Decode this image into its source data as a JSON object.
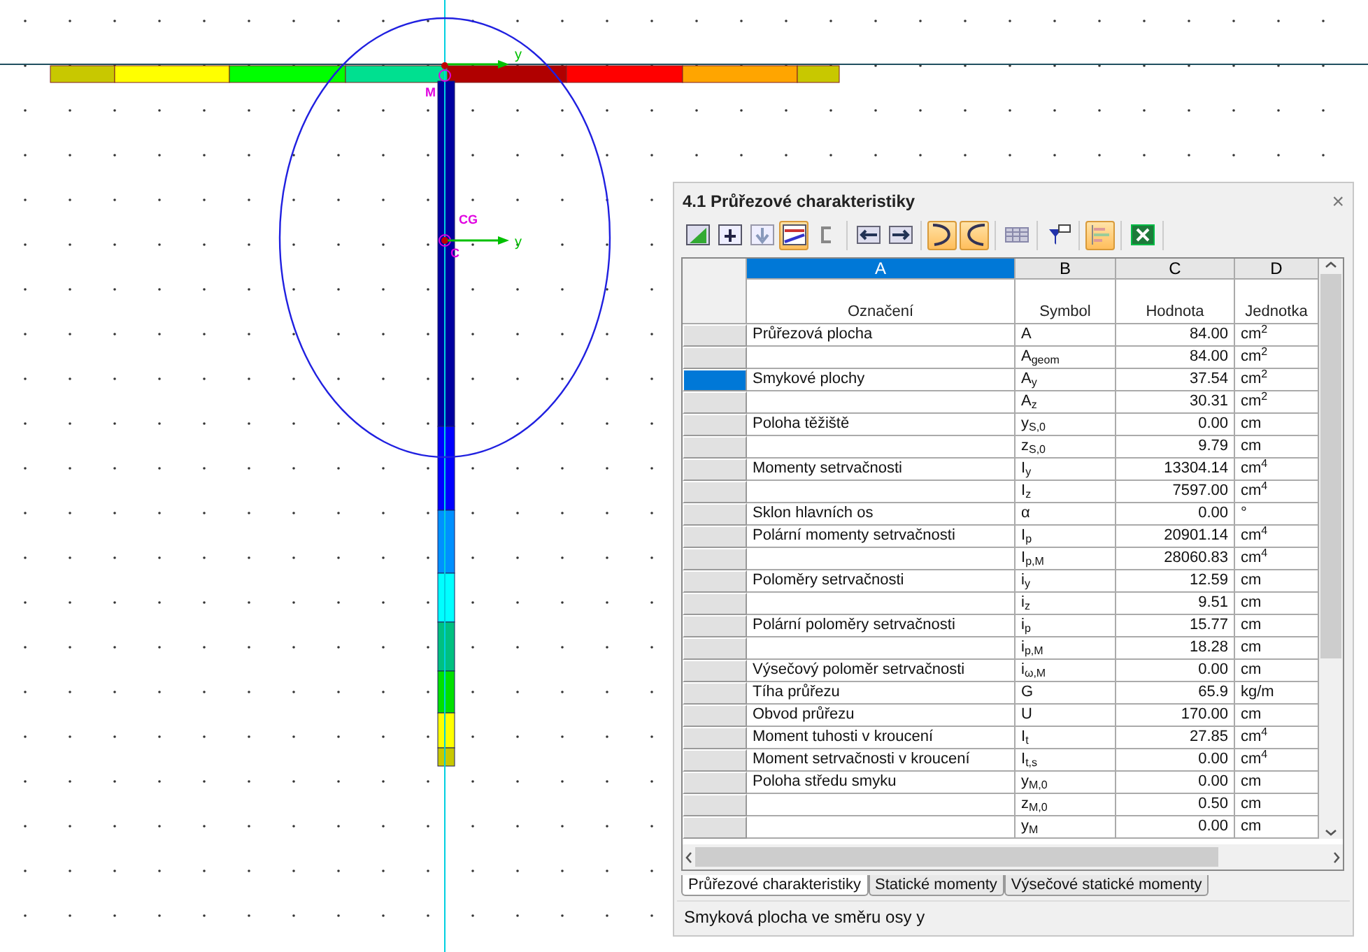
{
  "canvas": {
    "labels": [
      {
        "kind": "axis",
        "text": "y"
      },
      {
        "kind": "point",
        "text": "M"
      },
      {
        "kind": "point",
        "text": "CG"
      },
      {
        "kind": "point",
        "text": "C"
      },
      {
        "kind": "axis",
        "text": "y"
      }
    ]
  },
  "panel": {
    "title": "4.1 Průřezové charakteristiky",
    "close": "×",
    "toolbar": [
      [
        {
          "kind": "table-green",
          "pressed": false
        },
        {
          "kind": "insert",
          "pressed": false
        },
        {
          "kind": "down",
          "pressed": false
        },
        {
          "kind": "colors",
          "pressed": true
        },
        {
          "kind": "bracket",
          "pressed": false
        }
      ],
      [
        {
          "kind": "left",
          "pressed": false
        },
        {
          "kind": "right",
          "pressed": false
        }
      ],
      [
        {
          "kind": "undo",
          "pressed": true
        },
        {
          "kind": "redo",
          "pressed": true
        }
      ],
      [
        {
          "kind": "grid",
          "pressed": false
        }
      ],
      [
        {
          "kind": "filter",
          "pressed": false
        }
      ],
      [
        {
          "kind": "bars",
          "pressed": true
        }
      ],
      [
        {
          "kind": "excel",
          "pressed": false
        }
      ]
    ],
    "columns": [
      {
        "letter": "A",
        "heading": "Označení",
        "selected": true
      },
      {
        "letter": "B",
        "heading": "Symbol",
        "selected": false
      },
      {
        "letter": "C",
        "heading": "Hodnota",
        "selected": false
      },
      {
        "letter": "D",
        "heading": "Jednotka",
        "selected": false
      }
    ],
    "rows": [
      {
        "label": "Průřezová plocha",
        "symbol": "A",
        "value": "84.00",
        "unit": "cm$^{2}$",
        "selected": false
      },
      {
        "symbol": "A$_{geom}$",
        "value": "84.00",
        "unit": "cm$^{2}$",
        "selected": false
      },
      {
        "label": "Smykové plochy",
        "symbol": "A$_{y}$",
        "value": "37.54",
        "unit": "cm$^{2}$",
        "selected": true
      },
      {
        "symbol": "A$_{z}$",
        "value": "30.31",
        "unit": "cm$^{2}$",
        "selected": false
      },
      {
        "label": "Poloha těžiště",
        "symbol": "y$_{S,0}$",
        "value": "0.00",
        "unit": "cm",
        "selected": false
      },
      {
        "symbol": "z$_{S,0}$",
        "value": "9.79",
        "unit": "cm",
        "selected": false
      },
      {
        "label": "Momenty setrvačnosti",
        "symbol": "I$_{y}$",
        "value": "13304.14",
        "unit": "cm$^{4}$",
        "selected": false
      },
      {
        "symbol": "I$_{z}$",
        "value": "7597.00",
        "unit": "cm$^{4}$",
        "selected": false
      },
      {
        "label": "Sklon hlavních os",
        "symbol": "α",
        "value": "0.00",
        "unit": "°",
        "selected": false
      },
      {
        "label": "Polární momenty setrvačnosti",
        "symbol": "I$_{p}$",
        "value": "20901.14",
        "unit": "cm$^{4}$",
        "selected": false
      },
      {
        "symbol": "I$_{p,M}$",
        "value": "28060.83",
        "unit": "cm$^{4}$",
        "selected": false
      },
      {
        "label": "Poloměry setrvačnosti",
        "symbol": "i$_{y}$",
        "value": "12.59",
        "unit": "cm",
        "selected": false
      },
      {
        "symbol": "i$_{z}$",
        "value": "9.51",
        "unit": "cm",
        "selected": false
      },
      {
        "label": "Polární poloměry setrvačnosti",
        "symbol": "i$_{p}$",
        "value": "15.77",
        "unit": "cm",
        "selected": false
      },
      {
        "symbol": "i$_{p,M}$",
        "value": "18.28",
        "unit": "cm",
        "selected": false
      },
      {
        "label": "Výsečový poloměr setrvačnosti",
        "symbol": "i$_{ω,M}$",
        "value": "0.00",
        "unit": "cm",
        "selected": false
      },
      {
        "label": "Tíha průřezu",
        "symbol": "G",
        "value": "65.9",
        "unit": "kg/m",
        "selected": false
      },
      {
        "label": "Obvod průřezu",
        "symbol": "U",
        "value": "170.00",
        "unit": "cm",
        "selected": false
      },
      {
        "label": "Moment tuhosti v kroucení",
        "symbol": "I$_{t}$",
        "value": "27.85",
        "unit": "cm$^{4}$",
        "selected": false
      },
      {
        "label": "Moment setrvačnosti v kroucení",
        "symbol": "I$_{t,s}$",
        "value": "0.00",
        "unit": "cm$^{4}$",
        "selected": false
      },
      {
        "label": "Poloha středu smyku",
        "symbol": "y$_{M,0}$",
        "value": "0.00",
        "unit": "cm",
        "selected": false
      },
      {
        "symbol": "z$_{M,0}$",
        "value": "0.50",
        "unit": "cm",
        "selected": false
      },
      {
        "symbol": "y$_{M}$",
        "value": "0.00",
        "unit": "cm",
        "selected": false
      }
    ],
    "tabs": [
      {
        "label": "Průřezové charakteristiky",
        "selected": true
      },
      {
        "label": "Statické momenty",
        "selected": false
      },
      {
        "label": "Výsečové statické momenty",
        "selected": false
      }
    ],
    "status": "Smyková plocha ve směru osy y"
  }
}
